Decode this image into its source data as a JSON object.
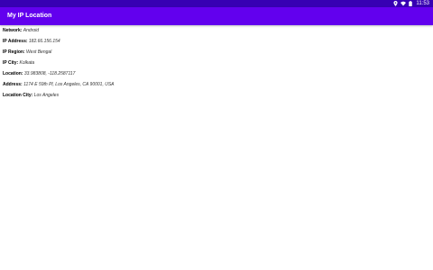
{
  "status_bar": {
    "time": "11:53",
    "icons": [
      "location-icon",
      "wifi-icon",
      "battery-icon"
    ]
  },
  "app_bar": {
    "title": "My IP Location"
  },
  "info": [
    {
      "label": "Network:",
      "value": "Android"
    },
    {
      "label": "IP Address:",
      "value": "182.66.156.154"
    },
    {
      "label": "IP Region:",
      "value": "West Bengal"
    },
    {
      "label": "IP City:",
      "value": "Kolkata"
    },
    {
      "label": "Location:",
      "value": "33.983808, -118.2587117"
    },
    {
      "label": "Address:",
      "value": "1174 E 59th Pl, Los Angeles, CA 90001, USA"
    },
    {
      "label": "Location City:",
      "value": "Los Angeles"
    }
  ],
  "colors": {
    "status_bar": "#3700b3",
    "app_bar": "#6200ee",
    "background": "#ffffff"
  }
}
